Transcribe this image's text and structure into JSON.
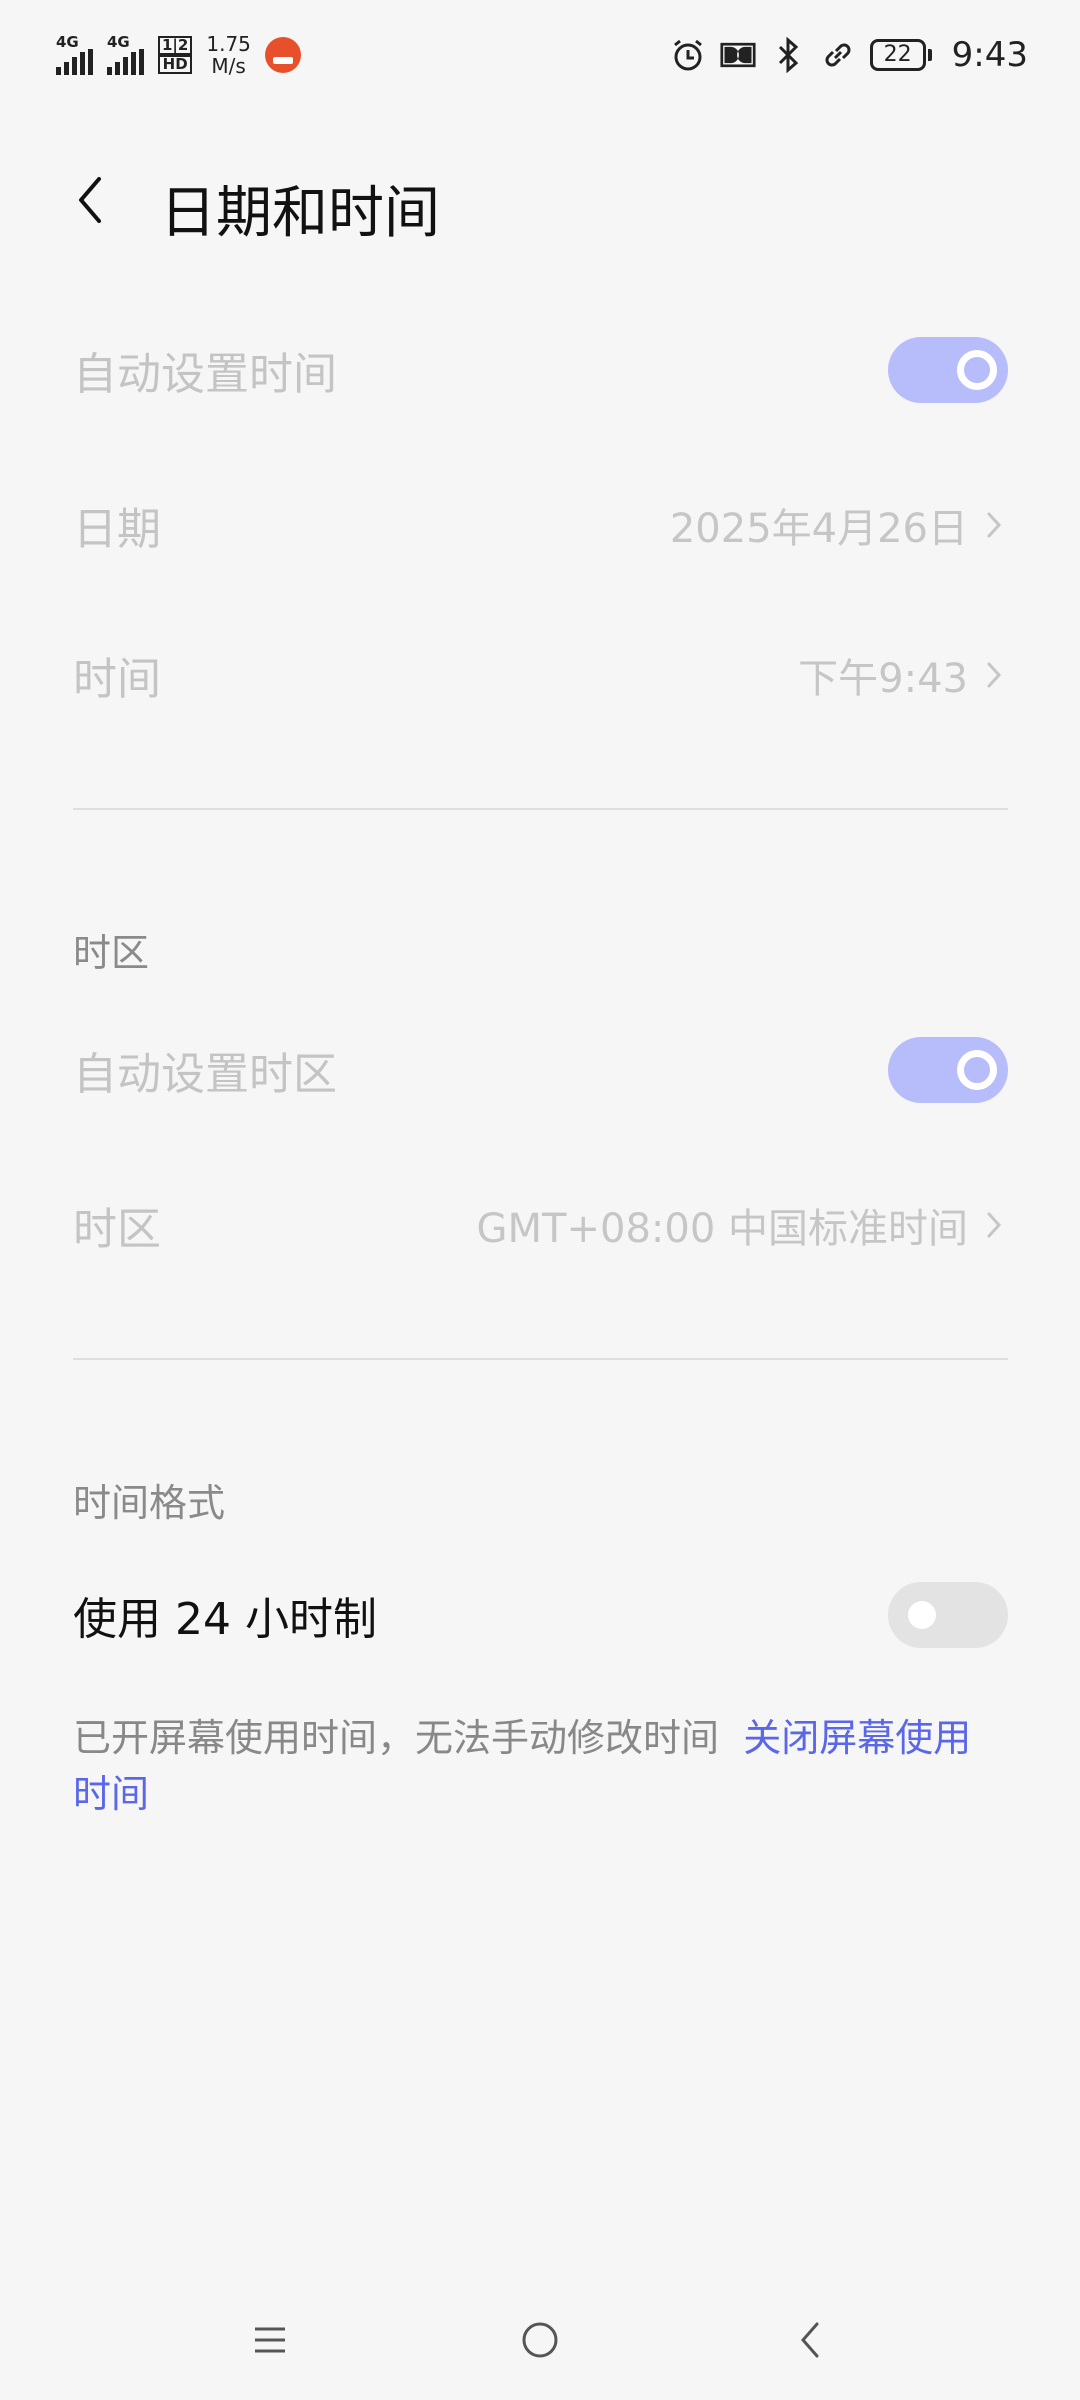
{
  "status_bar": {
    "network_1": "4G",
    "network_2": "4G",
    "sim_hd_top": "1|2",
    "sim_hd_bottom": "HD",
    "speed_value": "1.75",
    "speed_unit": "M/s",
    "battery": "22",
    "time": "9:43",
    "icons": [
      "signal-icon",
      "signal-icon",
      "hd-icon",
      "app-notification-icon",
      "alarm-icon",
      "dolby-icon",
      "bluetooth-icon",
      "link-icon",
      "battery-icon"
    ]
  },
  "header": {
    "title": "日期和时间",
    "back_icon": "chevron-left-icon"
  },
  "auto_time": {
    "label": "自动设置时间",
    "enabled": true
  },
  "date": {
    "label": "日期",
    "value": "2025年4月26日"
  },
  "time": {
    "label": "时间",
    "value": "下午9:43"
  },
  "timezone_section": {
    "title": "时区"
  },
  "auto_timezone": {
    "label": "自动设置时区",
    "enabled": true
  },
  "timezone": {
    "label": "时区",
    "value": "GMT+08:00 中国标准时间"
  },
  "format_section": {
    "title": "时间格式"
  },
  "use_24h": {
    "label": "使用 24 小时制",
    "enabled": false
  },
  "notice": {
    "text": "已开屏幕使用时间，无法手动修改时间",
    "link": "关闭屏幕使用时间"
  },
  "colors": {
    "accent": "#5a67e8",
    "toggle_on": "#b7bdfa",
    "toggle_off": "#e3e3e3",
    "background": "#f6f6f6"
  },
  "nav": {
    "icons": [
      "menu-icon",
      "home-icon",
      "back-icon"
    ]
  }
}
